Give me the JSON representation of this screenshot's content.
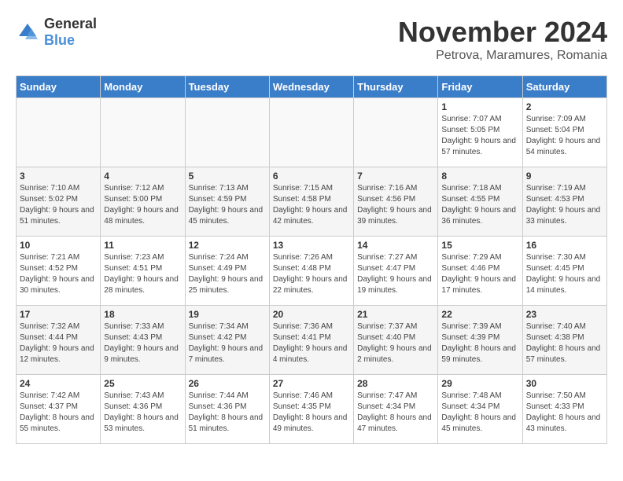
{
  "logo": {
    "general": "General",
    "blue": "Blue"
  },
  "header": {
    "month": "November 2024",
    "location": "Petrova, Maramures, Romania"
  },
  "weekdays": [
    "Sunday",
    "Monday",
    "Tuesday",
    "Wednesday",
    "Thursday",
    "Friday",
    "Saturday"
  ],
  "weeks": [
    [
      {
        "day": "",
        "info": ""
      },
      {
        "day": "",
        "info": ""
      },
      {
        "day": "",
        "info": ""
      },
      {
        "day": "",
        "info": ""
      },
      {
        "day": "",
        "info": ""
      },
      {
        "day": "1",
        "info": "Sunrise: 7:07 AM\nSunset: 5:05 PM\nDaylight: 9 hours and 57 minutes."
      },
      {
        "day": "2",
        "info": "Sunrise: 7:09 AM\nSunset: 5:04 PM\nDaylight: 9 hours and 54 minutes."
      }
    ],
    [
      {
        "day": "3",
        "info": "Sunrise: 7:10 AM\nSunset: 5:02 PM\nDaylight: 9 hours and 51 minutes."
      },
      {
        "day": "4",
        "info": "Sunrise: 7:12 AM\nSunset: 5:00 PM\nDaylight: 9 hours and 48 minutes."
      },
      {
        "day": "5",
        "info": "Sunrise: 7:13 AM\nSunset: 4:59 PM\nDaylight: 9 hours and 45 minutes."
      },
      {
        "day": "6",
        "info": "Sunrise: 7:15 AM\nSunset: 4:58 PM\nDaylight: 9 hours and 42 minutes."
      },
      {
        "day": "7",
        "info": "Sunrise: 7:16 AM\nSunset: 4:56 PM\nDaylight: 9 hours and 39 minutes."
      },
      {
        "day": "8",
        "info": "Sunrise: 7:18 AM\nSunset: 4:55 PM\nDaylight: 9 hours and 36 minutes."
      },
      {
        "day": "9",
        "info": "Sunrise: 7:19 AM\nSunset: 4:53 PM\nDaylight: 9 hours and 33 minutes."
      }
    ],
    [
      {
        "day": "10",
        "info": "Sunrise: 7:21 AM\nSunset: 4:52 PM\nDaylight: 9 hours and 30 minutes."
      },
      {
        "day": "11",
        "info": "Sunrise: 7:23 AM\nSunset: 4:51 PM\nDaylight: 9 hours and 28 minutes."
      },
      {
        "day": "12",
        "info": "Sunrise: 7:24 AM\nSunset: 4:49 PM\nDaylight: 9 hours and 25 minutes."
      },
      {
        "day": "13",
        "info": "Sunrise: 7:26 AM\nSunset: 4:48 PM\nDaylight: 9 hours and 22 minutes."
      },
      {
        "day": "14",
        "info": "Sunrise: 7:27 AM\nSunset: 4:47 PM\nDaylight: 9 hours and 19 minutes."
      },
      {
        "day": "15",
        "info": "Sunrise: 7:29 AM\nSunset: 4:46 PM\nDaylight: 9 hours and 17 minutes."
      },
      {
        "day": "16",
        "info": "Sunrise: 7:30 AM\nSunset: 4:45 PM\nDaylight: 9 hours and 14 minutes."
      }
    ],
    [
      {
        "day": "17",
        "info": "Sunrise: 7:32 AM\nSunset: 4:44 PM\nDaylight: 9 hours and 12 minutes."
      },
      {
        "day": "18",
        "info": "Sunrise: 7:33 AM\nSunset: 4:43 PM\nDaylight: 9 hours and 9 minutes."
      },
      {
        "day": "19",
        "info": "Sunrise: 7:34 AM\nSunset: 4:42 PM\nDaylight: 9 hours and 7 minutes."
      },
      {
        "day": "20",
        "info": "Sunrise: 7:36 AM\nSunset: 4:41 PM\nDaylight: 9 hours and 4 minutes."
      },
      {
        "day": "21",
        "info": "Sunrise: 7:37 AM\nSunset: 4:40 PM\nDaylight: 9 hours and 2 minutes."
      },
      {
        "day": "22",
        "info": "Sunrise: 7:39 AM\nSunset: 4:39 PM\nDaylight: 8 hours and 59 minutes."
      },
      {
        "day": "23",
        "info": "Sunrise: 7:40 AM\nSunset: 4:38 PM\nDaylight: 8 hours and 57 minutes."
      }
    ],
    [
      {
        "day": "24",
        "info": "Sunrise: 7:42 AM\nSunset: 4:37 PM\nDaylight: 8 hours and 55 minutes."
      },
      {
        "day": "25",
        "info": "Sunrise: 7:43 AM\nSunset: 4:36 PM\nDaylight: 8 hours and 53 minutes."
      },
      {
        "day": "26",
        "info": "Sunrise: 7:44 AM\nSunset: 4:36 PM\nDaylight: 8 hours and 51 minutes."
      },
      {
        "day": "27",
        "info": "Sunrise: 7:46 AM\nSunset: 4:35 PM\nDaylight: 8 hours and 49 minutes."
      },
      {
        "day": "28",
        "info": "Sunrise: 7:47 AM\nSunset: 4:34 PM\nDaylight: 8 hours and 47 minutes."
      },
      {
        "day": "29",
        "info": "Sunrise: 7:48 AM\nSunset: 4:34 PM\nDaylight: 8 hours and 45 minutes."
      },
      {
        "day": "30",
        "info": "Sunrise: 7:50 AM\nSunset: 4:33 PM\nDaylight: 8 hours and 43 minutes."
      }
    ]
  ]
}
